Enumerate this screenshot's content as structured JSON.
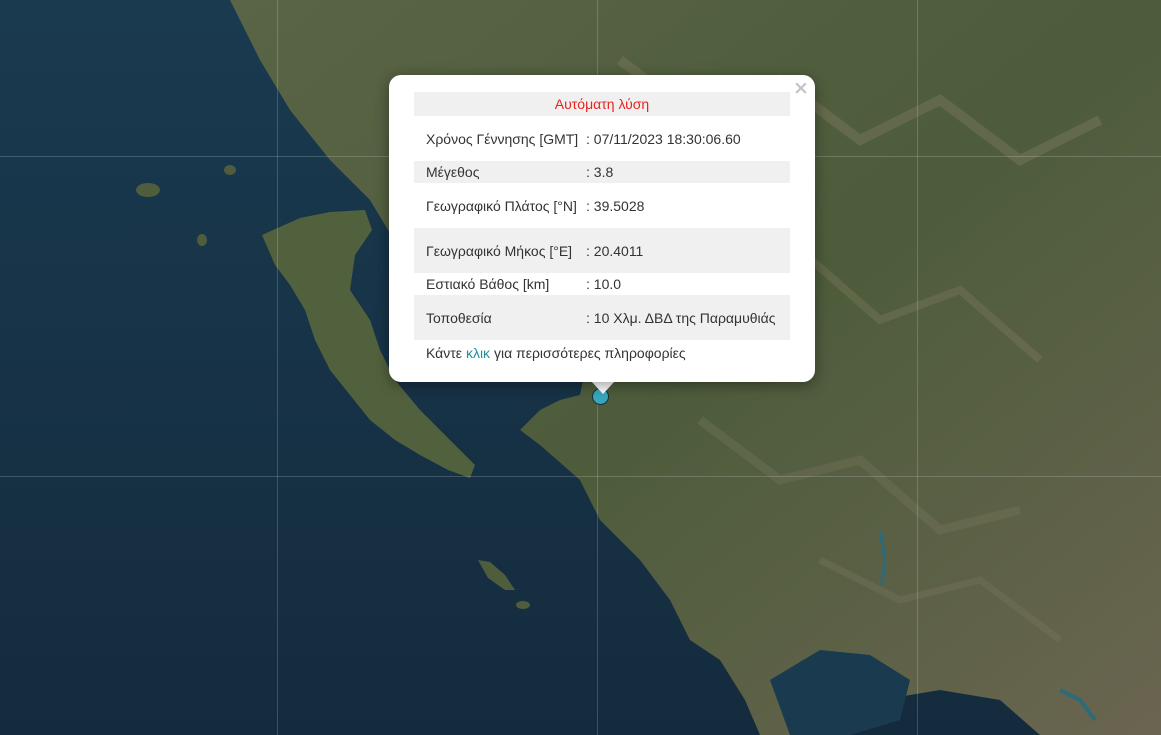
{
  "popup": {
    "close_label": "×",
    "title": "Αυτόματη λύση",
    "rows": [
      {
        "label": "Χρόνος Γέννησης [GMT]",
        "value": ": 07/11/2023 18:30:06.60"
      },
      {
        "label": "Μέγεθος",
        "value": ": 3.8"
      },
      {
        "label": "Γεωγραφικό Πλάτος [°N]",
        "value": ": 39.5028"
      },
      {
        "label": "Γεωγραφικό Μήκος [°E]",
        "value": ": 20.4011"
      },
      {
        "label": "Εστιακό Βάθος [km]",
        "value": ": 10.0"
      },
      {
        "label": "Τοποθεσία",
        "value": ": 10 Χλμ. ΔΒΔ της Παραμυθιάς"
      }
    ],
    "footer_prefix": "Κάντε",
    "footer_link": "κλικ",
    "footer_suffix": "για περισσότερες πληροφορίες"
  },
  "colors": {
    "title": "#e8231e",
    "link": "#1e8f99",
    "marker": "#3aa6bb",
    "sea": "#173246",
    "land": "#4a5b3a"
  },
  "icons": {
    "close": "close-icon",
    "marker": "earthquake-marker"
  }
}
